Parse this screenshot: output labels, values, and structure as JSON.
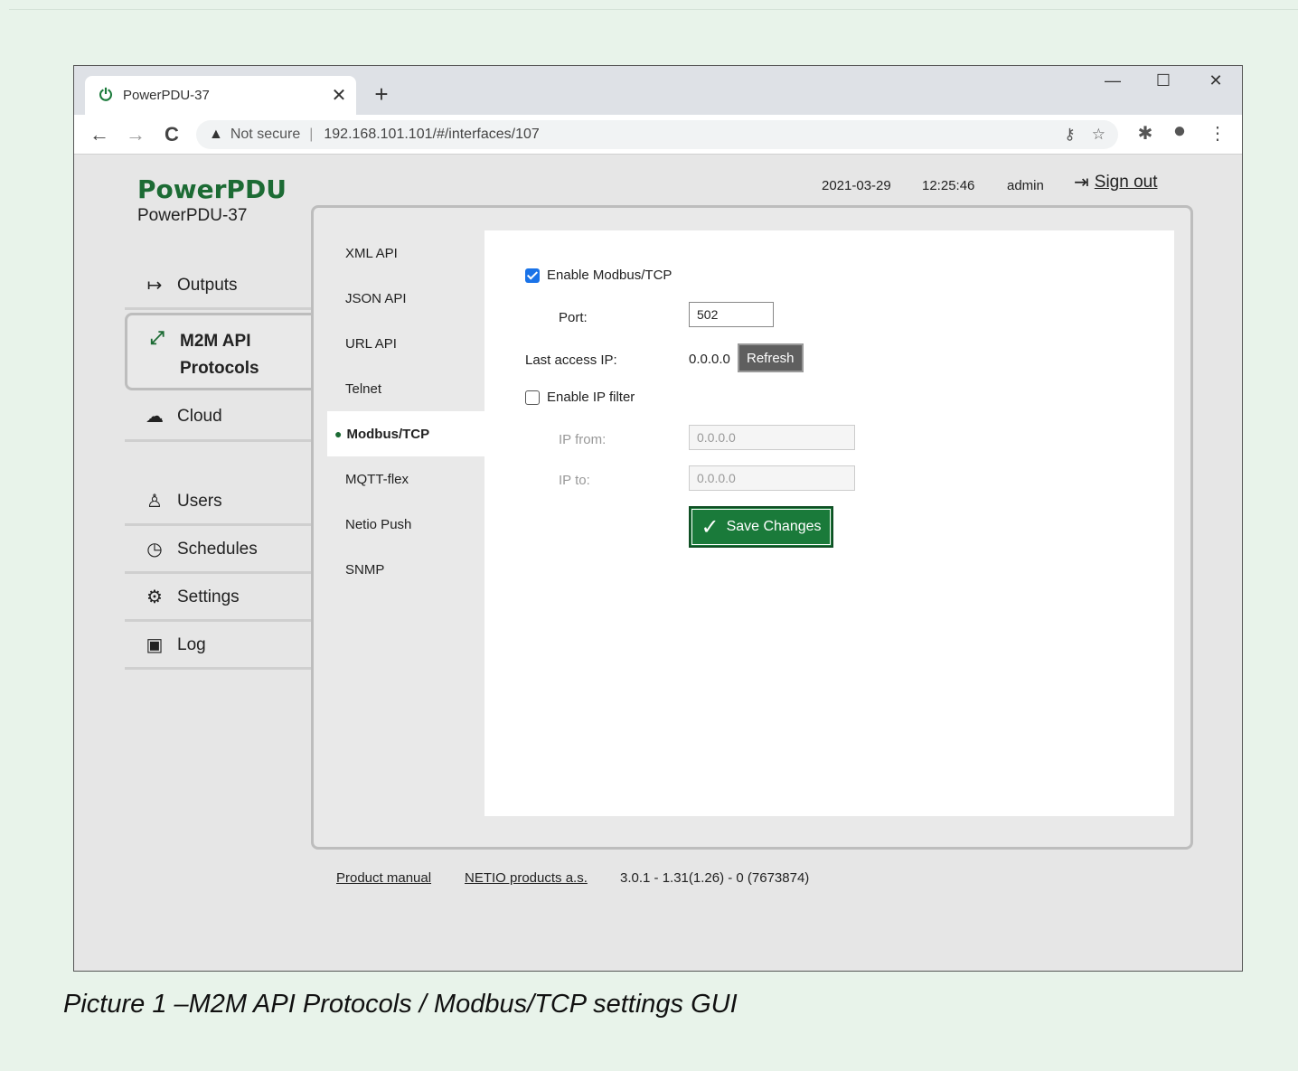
{
  "browser": {
    "tab_title": "PowerPDU-37",
    "tab_close": "✕",
    "new_tab": "+",
    "minimize": "—",
    "maximize": "☐",
    "close": "✕",
    "back": "←",
    "forward": "→",
    "reload": "C",
    "security_label": "Not secure",
    "separator": "|",
    "url": "192.168.101.101/#/interfaces/107"
  },
  "header": {
    "brand": "PowerPDU",
    "device_name": "PowerPDU-37",
    "date": "2021-03-29",
    "time": "12:25:46",
    "user": "admin",
    "sign_out": "Sign out"
  },
  "sidebar": {
    "items": [
      {
        "label": "Outputs",
        "icon": "arrow-right-icon"
      },
      {
        "label": "M2M API Protocols",
        "line1": "M2M API",
        "line2": "Protocols",
        "icon": "m2m-icon",
        "active": true
      },
      {
        "label": "Cloud",
        "icon": "cloud-icon"
      },
      {
        "label": "Users",
        "icon": "user-icon"
      },
      {
        "label": "Schedules",
        "icon": "clock-icon"
      },
      {
        "label": "Settings",
        "icon": "gear-icon"
      },
      {
        "label": "Log",
        "icon": "log-icon"
      }
    ]
  },
  "subnav": {
    "items": [
      "XML API",
      "JSON API",
      "URL API",
      "Telnet",
      "Modbus/TCP",
      "MQTT-flex",
      "Netio Push",
      "SNMP"
    ],
    "active": "Modbus/TCP"
  },
  "form": {
    "enable_modbus_label": "Enable Modbus/TCP",
    "enable_modbus_checked": true,
    "port_label": "Port:",
    "port_value": "502",
    "last_access_label": "Last access IP:",
    "last_access_value": "0.0.0.0",
    "refresh_label": "Refresh",
    "enable_ip_filter_label": "Enable IP filter",
    "enable_ip_filter_checked": false,
    "ip_from_label": "IP from:",
    "ip_from_value": "0.0.0.0",
    "ip_to_label": "IP to:",
    "ip_to_value": "0.0.0.0",
    "save_label": "Save Changes"
  },
  "footer": {
    "manual": "Product manual",
    "company": "NETIO products a.s.",
    "version": "3.0.1 - 1.31(1.26) - 0 (7673874)"
  },
  "caption": "Picture 1 –M2M API Protocols / Modbus/TCP settings GUI",
  "colors": {
    "brand_green": "#1c6b34",
    "save_green": "#1a7a3a",
    "checkbox_blue": "#1a73e8",
    "page_background": "#e8f3ea"
  }
}
